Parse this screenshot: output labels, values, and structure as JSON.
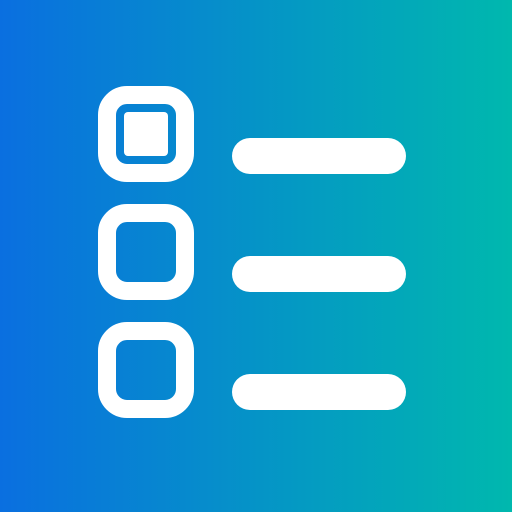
{
  "icon": {
    "name": "checklist-icon",
    "colors": {
      "gradient_start": "#0A6FE0",
      "gradient_end": "#00B8AE",
      "foreground": "#FFFFFF"
    },
    "checklist": {
      "items": [
        {
          "checked": true
        },
        {
          "checked": false
        },
        {
          "checked": false
        }
      ]
    }
  }
}
